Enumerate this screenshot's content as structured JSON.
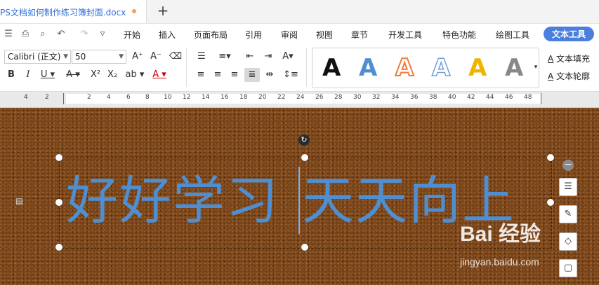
{
  "tab": {
    "title": "PS文档如何制作练习簿封面.docx",
    "new_tab": "+"
  },
  "quick_icons": [
    "menu-icon",
    "print-icon",
    "print-preview-icon",
    "undo-icon",
    "redo-icon",
    "more-icon"
  ],
  "menu": {
    "items": [
      "开始",
      "插入",
      "页面布局",
      "引用",
      "审阅",
      "视图",
      "章节",
      "开发工具",
      "特色功能",
      "绘图工具"
    ],
    "active": "文本工具"
  },
  "ribbon": {
    "font_name": "Calibri (正文)",
    "font_size": "50",
    "style_gallery_letter": "A",
    "style_colors": [
      "#111111",
      "#4f8fd1",
      "#f07b3a",
      "#6e9fd8",
      "#f0b400",
      "#888888"
    ],
    "text_fill_label": "文本填充",
    "text_outline_label": "文本轮廓"
  },
  "ruler": {
    "labels": [
      "4",
      "2",
      "2",
      "4",
      "6",
      "8",
      "10",
      "12",
      "14",
      "16",
      "18",
      "20",
      "22",
      "24",
      "26",
      "28",
      "30",
      "32",
      "34",
      "36",
      "38",
      "40",
      "42",
      "44",
      "46",
      "48"
    ]
  },
  "canvas": {
    "text_left": "好好学习",
    "text_right": "天天向上",
    "text_color": "#4f8fd1",
    "watermark_text": "Bai 经验",
    "watermark_url": "jingyan.baidu.com"
  }
}
